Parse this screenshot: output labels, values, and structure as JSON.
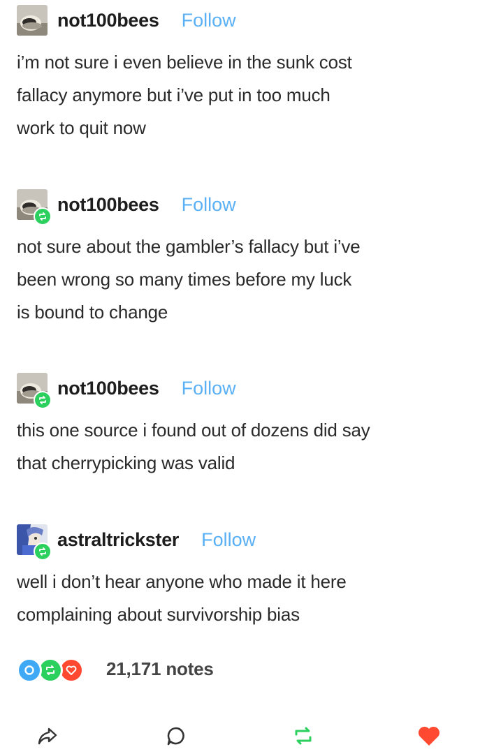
{
  "posts": [
    {
      "username": "not100bees",
      "follow_label": "Follow",
      "reblogged": false,
      "avatar": "rock-avatar",
      "text": "i’m not sure i even believe in the sunk cost\nfallacy anymore but i’ve put in too much\nwork to quit now"
    },
    {
      "username": "not100bees",
      "follow_label": "Follow",
      "reblogged": true,
      "avatar": "rock-avatar",
      "text": "not sure about the gambler’s fallacy but i’ve\nbeen wrong so many times before my luck\nis bound to change"
    },
    {
      "username": "not100bees",
      "follow_label": "Follow",
      "reblogged": true,
      "avatar": "rock-avatar",
      "text": "this one source i found out of dozens did say\nthat cherrypicking was valid"
    },
    {
      "username": "astraltrickster",
      "follow_label": "Follow",
      "reblogged": true,
      "avatar": "character-avatar",
      "text": "well i don’t hear anyone who made it here\ncomplaining about survivorship bias"
    }
  ],
  "notes": {
    "count_label": "21,171 notes",
    "icons": [
      "reply-note-icon",
      "reblog-note-icon",
      "like-note-icon"
    ]
  },
  "actions": {
    "share": "share-icon",
    "reply": "reply-icon",
    "reblog": "reblog-icon",
    "like": "heart-icon"
  },
  "colors": {
    "follow": "#5ab0f5",
    "reblog_green": "#2cd05f",
    "reply_blue": "#3fa9f5",
    "like_red": "#ff4930",
    "text": "#2a2a2a"
  }
}
